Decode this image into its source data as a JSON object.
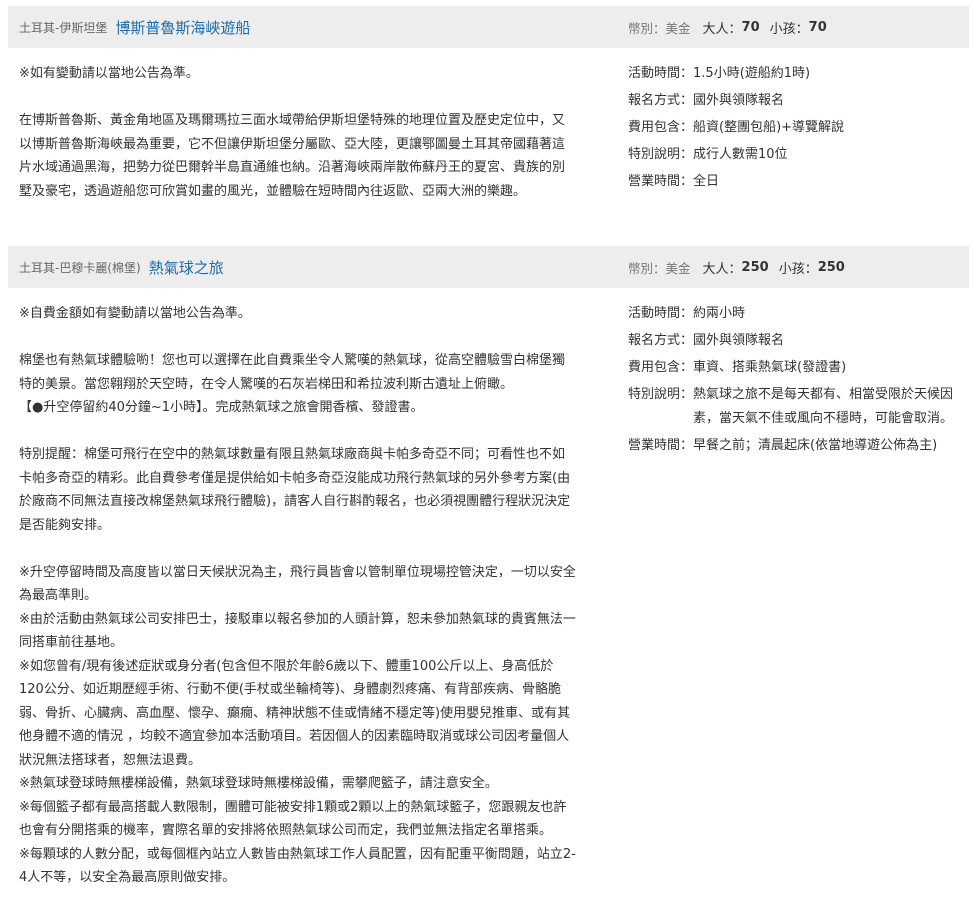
{
  "tours": [
    {
      "region": "土耳其-伊斯坦堡",
      "name": "博斯普魯斯海峽遊船",
      "currency_label": "幣別：",
      "currency": "美金",
      "adult_label": "大人：",
      "adult_price": "70",
      "child_label": "小孩：",
      "child_price": "70",
      "paragraphs": [
        "※如有變動請以當地公告為準。",
        "在博斯普魯斯、黃金角地區及瑪爾瑪拉三面水域帶給伊斯坦堡特殊的地理位置及歷史定位中，又以博斯普魯斯海峽最為重要，它不但讓伊斯坦堡分屬歐、亞大陸，更讓鄂圖曼土耳其帝國藉著這片水域通過黑海，把勢力從巴爾幹半島直通維也納。沿著海峽兩岸散佈蘇丹王的夏宮、貴族的別墅及豪宅，透過遊船您可欣賞如畫的風光，並體驗在短時間內往返歐、亞兩大洲的樂趣。"
      ],
      "info": [
        {
          "label": "活動時間：",
          "value": "1.5小時(遊船約1時)"
        },
        {
          "label": "報名方式：",
          "value": "國外與領隊報名"
        },
        {
          "label": "費用包含：",
          "value": "船資(整團包船)+導覽解說"
        },
        {
          "label": "特別說明：",
          "value": "成行人數需10位"
        },
        {
          "label": "營業時間：",
          "value": "全日"
        }
      ]
    },
    {
      "region": "土耳其-巴穆卡麗(棉堡)",
      "name": "熱氣球之旅",
      "currency_label": "幣別：",
      "currency": "美金",
      "adult_label": "大人：",
      "adult_price": "250",
      "child_label": "小孩：",
      "child_price": "250",
      "paragraphs": [
        "※自費金額如有變動請以當地公告為準。",
        "棉堡也有熱氣球體驗喲！您也可以選擇在此自費乘坐令人驚嘆的熱氣球，從高空體驗雪白棉堡獨特的美景。當您翱翔於天空時，在令人驚嘆的石灰岩梯田和希拉波利斯古遺址上俯瞰。",
        "【●升空停留約40分鐘~1小時】。完成熱氣球之旅會開香檳、發證書。",
        "特別提醒：棉堡可飛行在空中的熱氣球數量有限且熱氣球廠商與卡帕多奇亞不同；可看性也不如卡帕多奇亞的精彩。此自費參考僅是提供給如卡帕多奇亞沒能成功飛行熱氣球的另外參考方案(由於廠商不同無法直接改棉堡熱氣球飛行體驗)，請客人自行斟酌報名，也必須視團體行程狀況決定是否能夠安排。",
        "※升空停留時間及高度皆以當日天候狀況為主，飛行員皆會以管制單位現場控管決定，一切以安全為最高準則。",
        "※由於活動由熱氣球公司安排巴士，接駁車以報名參加的人頭計算，恕未參加熱氣球的貴賓無法一同搭車前往基地。",
        "※如您曾有/現有後述症狀或身分者(包含但不限於年齡6歲以下、體重100公斤以上、身高低於120公分、如近期歷經手術、行動不便(手杖或坐輪椅等)、身體劇烈疼痛、有背部疾病、骨骼脆弱、骨折、心臟病、高血壓、懷孕、癲癇、精神狀態不佳或情緒不穩定等)使用嬰兒推車、或有其他身體不適的情況 ，均較不適宜參加本活動項目。若因個人的因素臨時取消或球公司因考量個人狀況無法搭球者，恕無法退費。",
        "※熱氣球登球時無樓梯設備，熱氣球登球時無樓梯設備，需攀爬籃子，請注意安全。",
        "※每個籃子都有最高搭載人數限制，團體可能被安排1顆或2顆以上的熱氣球籃子，您跟親友也許也會有分開搭乘的機率，實際名單的安排將依照熱氣球公司而定，我們並無法指定名單搭乘。",
        "※每顆球的人數分配，或每個框內站立人數皆由熱氣球工作人員配置，因有配重平衡問題，站立2-4人不等，以安全為最高原則做安排。"
      ],
      "info": [
        {
          "label": "活動時間：",
          "value": "約兩小時"
        },
        {
          "label": "報名方式：",
          "value": "國外與領隊報名"
        },
        {
          "label": "費用包含：",
          "value": "車資、搭乘熱氣球(發證書)"
        },
        {
          "label": "特別說明：",
          "value": "熱氣球之旅不是每天都有、相當受限於天候因素，當天氣不佳或風向不穩時，可能會取消。"
        },
        {
          "label": "營業時間：",
          "value": "早餐之前；清晨起床(依當地導遊公佈為主)"
        }
      ]
    }
  ]
}
